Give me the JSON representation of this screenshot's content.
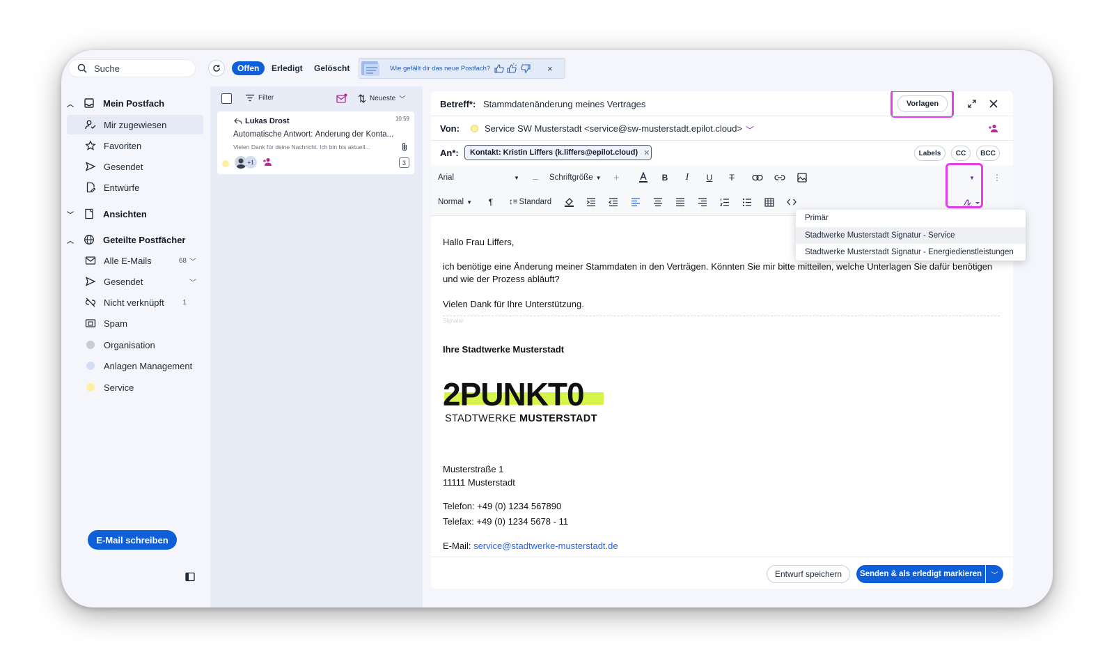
{
  "sidebar": {
    "search_placeholder": "Suche",
    "my_mailbox": "Mein Postfach",
    "items": [
      {
        "label": "Mir zugewiesen"
      },
      {
        "label": "Favoriten"
      },
      {
        "label": "Gesendet"
      },
      {
        "label": "Entwürfe"
      }
    ],
    "views": "Ansichten",
    "shared": "Geteilte Postfächer",
    "shared_items": [
      {
        "label": "Alle E-Mails",
        "count": "68"
      },
      {
        "label": "Gesendet"
      },
      {
        "label": "Nicht verknüpft",
        "count": "1"
      },
      {
        "label": "Spam"
      },
      {
        "label": "Organisation",
        "color": "#c9ccd3"
      },
      {
        "label": "Anlagen Management",
        "color": "#d4ddf4"
      },
      {
        "label": "Service",
        "color": "#fdf0a0"
      }
    ],
    "compose_label": "E-Mail schreiben"
  },
  "topbar": {
    "tabs": [
      "Offen",
      "Erledigt",
      "Gelöscht"
    ],
    "feedback_text": "Wie gefällt dir das neue Postfach?",
    "feedback_close": "×"
  },
  "maillist": {
    "filter_label": "Filter",
    "sort_label": "Neueste",
    "mail": {
      "sender": "Lukas Drost",
      "time": "10:59",
      "subject": "Automatische Antwort: Änderung der Konta...",
      "preview": "Vielen Dank für deine Nachricht. Ich bin bis aktuell...",
      "avatar_extra": "+1",
      "thread_count": "3"
    }
  },
  "composer": {
    "subject_label": "Betreff*:",
    "subject": "Stammdatenänderung meines Vertrages",
    "templates_button": "Vorlagen",
    "from_label": "Von:",
    "from": "Service SW Musterstadt <service@sw-musterstadt.epilot.cloud>",
    "to_label": "An*:",
    "to_chip": "Kontakt: Kristin Liffers (k.liffers@epilot.cloud)",
    "labels_button": "Labels",
    "cc_button": "CC",
    "bcc_button": "BCC",
    "font_family": "Arial",
    "font_size_label": "Schriftgröße",
    "paragraph_style": "Normal",
    "line_height": "Standard",
    "signature_options": [
      "Primär",
      "Stadtwerke Musterstadt Signatur - Service",
      "Stadtwerke Musterstadt Signatur - Energiedienstleistungen"
    ],
    "body": {
      "greeting": "Hallo Frau Liffers,",
      "paragraph1": "ich benötige eine Änderung meiner Stammdaten in den Verträgen. Könnten Sie mir bitte mitteilen, welche Unterlagen Sie dafür benötigen und wie der Prozess abläuft?",
      "paragraph2": "Vielen Dank für Ihre Unterstützung.",
      "signature_marker": "Signatur",
      "sig_title": "Ihre Stadtwerke Musterstadt",
      "logo_main": "2PUNKT0",
      "logo_sub_light": "STADTWERKE ",
      "logo_sub_bold": "MUSTERSTADT",
      "street": "Musterstraße 1",
      "city": "11111 Musterstadt",
      "phone": "Telefon: +49 (0) 1234 567890",
      "fax": "Telefax: +49 (0) 1234 5678 - 11",
      "email_label": "E-Mail: ",
      "email_link": "service@stadtwerke-musterstadt.de"
    },
    "save_draft": "Entwurf speichern",
    "send_done": "Senden & als erledigt markieren"
  },
  "colors": {
    "accent": "#0e5fd8",
    "highlight": "#e83ee8",
    "logo_green": "#d6f54a"
  }
}
